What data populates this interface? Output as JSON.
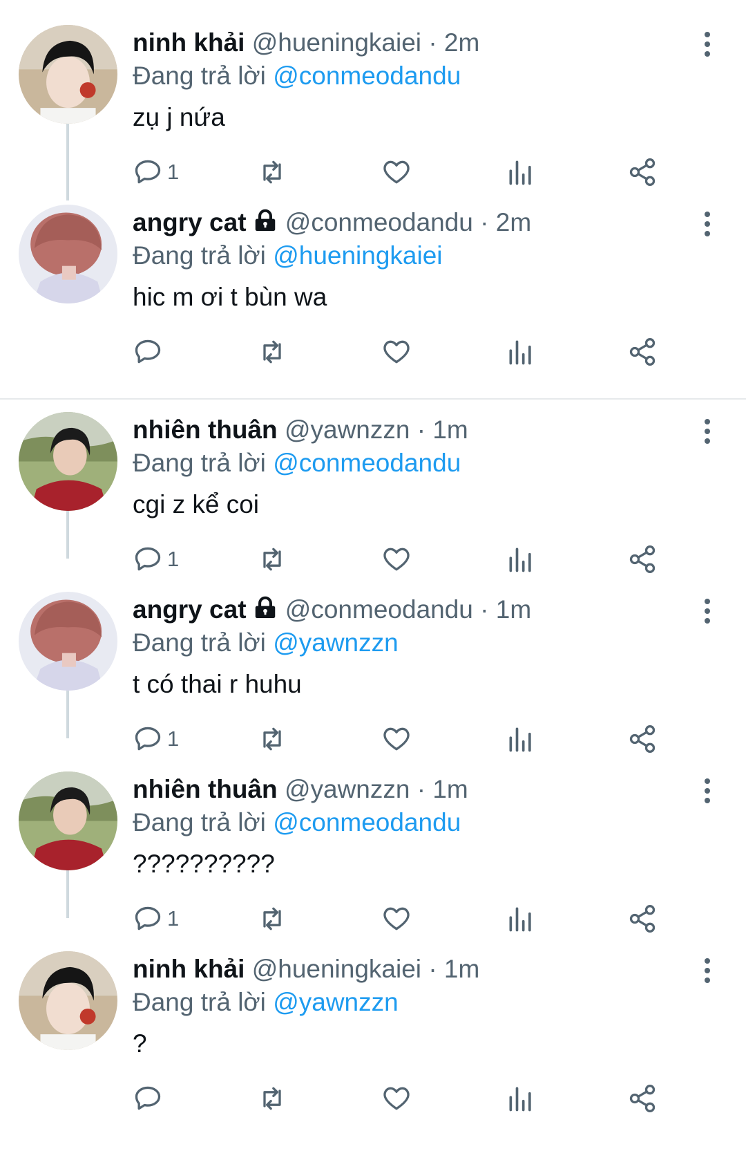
{
  "reply_prefix": "Đang trả lời",
  "tweets": [
    {
      "name": "ninh khải",
      "locked": false,
      "handle": "@hueningkaiei",
      "time": "2m",
      "reply_to": "@conmeodandu",
      "text": "zụ j nứa",
      "reply_count": "1"
    },
    {
      "name": "angry cat",
      "locked": true,
      "handle": "@conmeodandu",
      "time": "2m",
      "reply_to": "@hueningkaiei",
      "text": "hic m ơi t bùn wa",
      "reply_count": ""
    },
    {
      "name": "nhiên thuân",
      "locked": false,
      "handle": "@yawnzzn",
      "time": "1m",
      "reply_to": "@conmeodandu",
      "text": "cgi z kể coi",
      "reply_count": "1"
    },
    {
      "name": "angry cat",
      "locked": true,
      "handle": "@conmeodandu",
      "time": "1m",
      "reply_to": "@yawnzzn",
      "text": "t có thai r huhu",
      "reply_count": "1"
    },
    {
      "name": "nhiên thuân",
      "locked": false,
      "handle": "@yawnzzn",
      "time": "1m",
      "reply_to": "@conmeodandu",
      "text": "??????????",
      "reply_count": "1"
    },
    {
      "name": "ninh khải",
      "locked": false,
      "handle": "@hueningkaiei",
      "time": "1m",
      "reply_to": "@yawnzzn",
      "text": "?",
      "reply_count": ""
    }
  ],
  "icons": {
    "reply": "reply-icon",
    "retweet": "retweet-icon",
    "like": "heart-icon",
    "views": "views-icon",
    "share": "share-icon",
    "more": "more-vertical-icon",
    "lock": "lock-icon"
  },
  "colors": {
    "text": "#0f1419",
    "secondary": "#536471",
    "mention": "#1d9bf0",
    "thread_line": "#cfd9de"
  }
}
